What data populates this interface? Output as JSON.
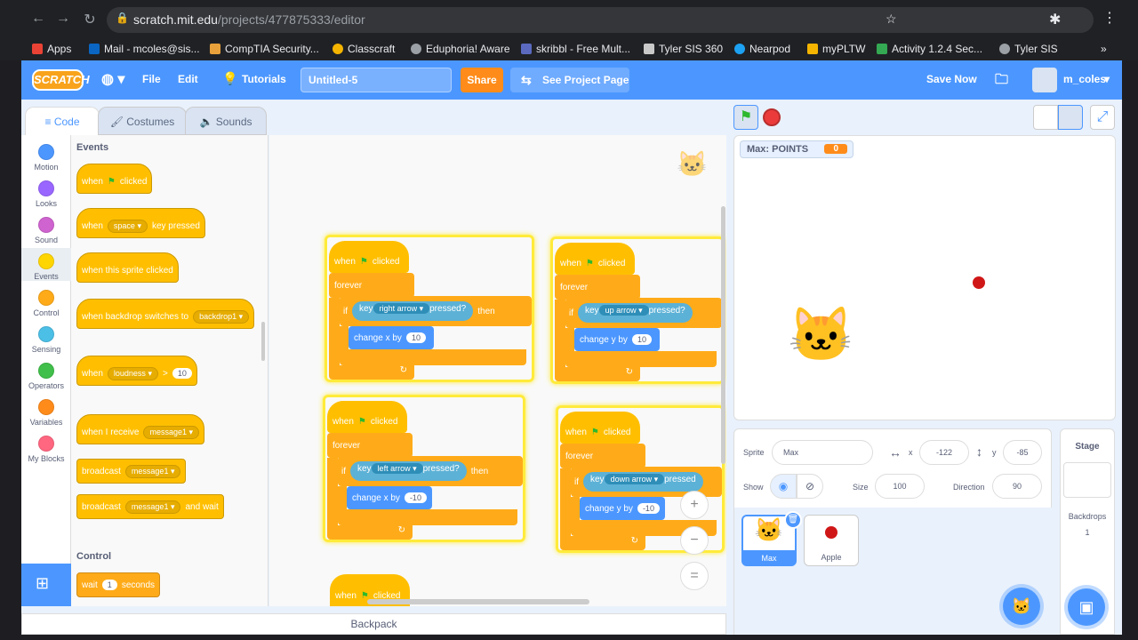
{
  "browser": {
    "url_host": "scratch.mit.edu",
    "url_path": "/projects/477875333/editor",
    "bookmarks": [
      "Apps",
      "Mail - mcoles@sis...",
      "CompTIA Security...",
      "Classcraft",
      "Eduphoria! Aware",
      "skribbl - Free Mult...",
      "Tyler SIS 360",
      "Nearpod",
      "myPLTW",
      "Activity 1.2.4 Sec...",
      "Tyler SIS"
    ],
    "bookmarks_more": "»"
  },
  "menu": {
    "logo": "SCRATCH",
    "file": "File",
    "edit": "Edit",
    "tutorials": "Tutorials",
    "project_title": "Untitled-5",
    "share": "Share",
    "see_project": "See Project Page",
    "save_now": "Save Now",
    "username": "m_coles"
  },
  "tabs": {
    "code": "Code",
    "costumes": "Costumes",
    "sounds": "Sounds"
  },
  "categories": [
    {
      "label": "Motion",
      "color": "#4c97ff"
    },
    {
      "label": "Looks",
      "color": "#9966ff"
    },
    {
      "label": "Sound",
      "color": "#cf63cf"
    },
    {
      "label": "Events",
      "color": "#ffd500"
    },
    {
      "label": "Control",
      "color": "#ffab19"
    },
    {
      "label": "Sensing",
      "color": "#4cbfe6"
    },
    {
      "label": "Operators",
      "color": "#40bf4a"
    },
    {
      "label": "Variables",
      "color": "#ff8c1a"
    },
    {
      "label": "My Blocks",
      "color": "#ff6680"
    }
  ],
  "palette": {
    "events_heading": "Events",
    "control_heading": "Control",
    "when": "when",
    "clicked": "clicked",
    "space": "space",
    "key_pressed": "key pressed",
    "sprite_clicked": "when this sprite clicked",
    "backdrop_switches": "when backdrop switches to",
    "backdrop1": "backdrop1",
    "loudness": "loudness",
    "gt": ">",
    "ten": "10",
    "when_i_receive": "when I receive",
    "message1": "message1",
    "broadcast": "broadcast",
    "and_wait": "and wait",
    "wait": "wait",
    "one": "1",
    "seconds": "seconds"
  },
  "scripts": [
    {
      "key": "right arrow",
      "action": "change x by",
      "value": "10"
    },
    {
      "key": "up arrow",
      "action": "change y by",
      "value": "10"
    },
    {
      "key": "left arrow",
      "action": "change x by",
      "value": "-10"
    },
    {
      "key": "down arrow",
      "action": "change y by",
      "value": "-10"
    }
  ],
  "script_words": {
    "when": "when",
    "clicked": "clicked",
    "forever": "forever",
    "if": "if",
    "key": "key",
    "pressed": "pressed?",
    "then": "then",
    "pressed_cut": "pressed"
  },
  "zoom": {
    "in": "+",
    "out": "−",
    "reset": "="
  },
  "backpack": "Backpack",
  "stage": {
    "monitor_label": "Max: POINTS",
    "monitor_value": "0"
  },
  "sprite_info": {
    "sprite_label": "Sprite",
    "sprite_name": "Max",
    "x_label": "x",
    "x": "-122",
    "y_label": "y",
    "y": "-85",
    "show_label": "Show",
    "size_label": "Size",
    "size": "100",
    "direction_label": "Direction",
    "direction": "90"
  },
  "sprites": [
    {
      "name": "Max",
      "selected": true
    },
    {
      "name": "Apple",
      "selected": false
    }
  ],
  "stage_panel": {
    "title": "Stage",
    "backdrops_label": "Backdrops",
    "backdrops_count": "1"
  }
}
